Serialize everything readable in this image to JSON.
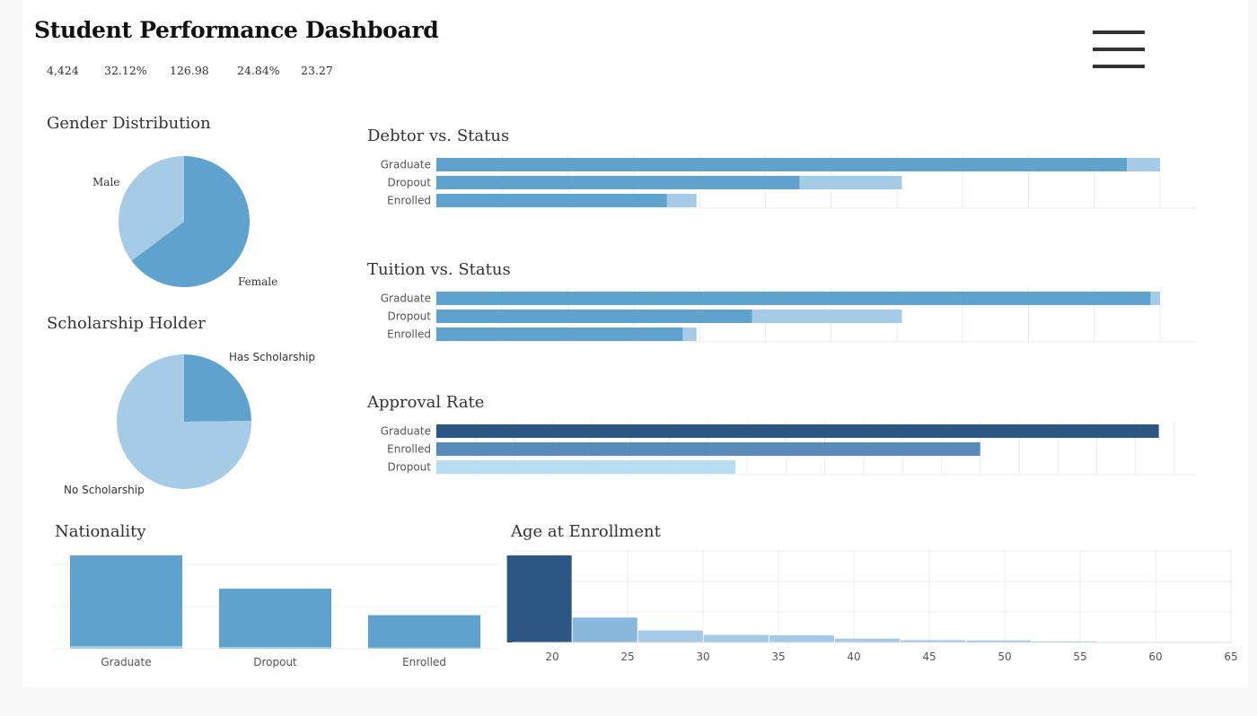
{
  "header": {
    "title": "Student Performance Dashboard",
    "kpis": [
      "4,424",
      "32.12%",
      "126.98",
      "24.84%",
      "23.27"
    ]
  },
  "menu": {
    "icon": "hamburger-menu-icon"
  },
  "colors": {
    "blue": "#5fa2cd",
    "light_blue": "#a5cbe6",
    "dark_blue": "#2c5784",
    "mid_blue": "#5a8bb8",
    "pale_blue": "#b8dcf0",
    "grid": "#ececec"
  },
  "charts": {
    "gender": {
      "title": "Gender Distribution"
    },
    "scholarship": {
      "title": "Scholarship Holder"
    },
    "debtor": {
      "title": "Debtor vs. Status"
    },
    "tuition": {
      "title": "Tuition vs. Status"
    },
    "approval": {
      "title": "Approval Rate"
    },
    "nationality": {
      "title": "Nationality"
    },
    "age": {
      "title": "Age at Enrollment"
    }
  },
  "chart_data": [
    {
      "id": "gender",
      "type": "pie",
      "title": "Gender Distribution",
      "labels": [
        "Female",
        "Male"
      ],
      "values": [
        64.8,
        35.2
      ]
    },
    {
      "id": "scholarship",
      "type": "pie",
      "title": "Scholarship Holder",
      "labels": [
        "Has Scholarship",
        "No Scholarship"
      ],
      "values": [
        24.8,
        75.2
      ]
    },
    {
      "id": "debtor",
      "type": "bar",
      "orientation": "horizontal",
      "stacked": true,
      "title": "Debtor vs. Status",
      "categories": [
        "Graduate",
        "Dropout",
        "Enrolled"
      ],
      "series": [
        {
          "values": [
            2108,
            1109,
            704
          ]
        },
        {
          "values": [
            101,
            312,
            90
          ]
        }
      ]
    },
    {
      "id": "tuition",
      "type": "bar",
      "orientation": "horizontal",
      "stacked": true,
      "title": "Tuition vs. Status",
      "categories": [
        "Graduate",
        "Dropout",
        "Enrolled"
      ],
      "series": [
        {
          "values": [
            2180,
            964,
            752
          ]
        },
        {
          "values": [
            29,
            457,
            42
          ]
        }
      ]
    },
    {
      "id": "approval",
      "type": "bar",
      "orientation": "horizontal",
      "title": "Approval Rate",
      "categories": [
        "Graduate",
        "Enrolled",
        "Dropout"
      ],
      "values": [
        0.93,
        0.7,
        0.385
      ]
    },
    {
      "id": "nationality",
      "type": "bar",
      "stacked": true,
      "title": "Nationality",
      "categories": [
        "Graduate",
        "Dropout",
        "Enrolled"
      ],
      "series": [
        {
          "values": [
            2150,
            1380,
            768
          ]
        },
        {
          "values": [
            59,
            41,
            26
          ]
        }
      ],
      "ylim": [
        0,
        2200
      ]
    },
    {
      "id": "age",
      "type": "bar",
      "title": "Age at Enrollment",
      "xticks": [
        20,
        25,
        30,
        35,
        40,
        45,
        50,
        55,
        60,
        65
      ],
      "bins": [
        {
          "start": 17,
          "end": 21.35,
          "count": 1960
        },
        {
          "start": 21.35,
          "end": 25.7,
          "count": 560
        },
        {
          "start": 25.7,
          "end": 30.05,
          "count": 270
        },
        {
          "start": 30.05,
          "end": 34.4,
          "count": 170
        },
        {
          "start": 34.4,
          "end": 38.75,
          "count": 160
        },
        {
          "start": 38.75,
          "end": 43.1,
          "count": 85
        },
        {
          "start": 43.1,
          "end": 47.45,
          "count": 50
        },
        {
          "start": 47.45,
          "end": 51.8,
          "count": 45
        },
        {
          "start": 51.8,
          "end": 56.15,
          "count": 25
        },
        {
          "start": 56.15,
          "end": 60.5,
          "count": 4
        },
        {
          "start": 60.5,
          "end": 64.85,
          "count": 3
        },
        {
          "start": 64.85,
          "end": 69.2,
          "count": 1
        }
      ],
      "ylim": [
        0,
        2000
      ]
    }
  ]
}
